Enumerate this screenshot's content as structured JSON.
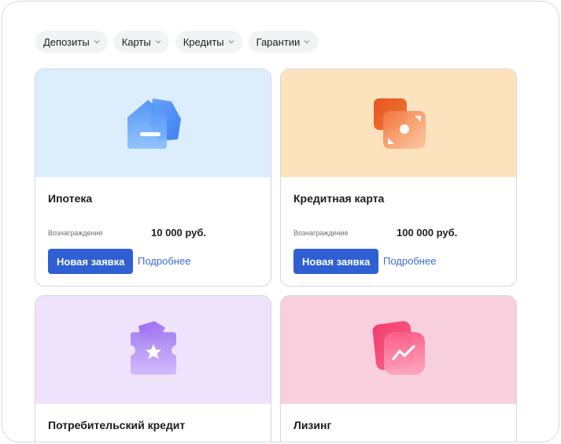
{
  "filters": [
    {
      "label": "Депозиты"
    },
    {
      "label": "Карты"
    },
    {
      "label": "Кредиты"
    },
    {
      "label": "Гарантии"
    }
  ],
  "cards": [
    {
      "title": "Ипотека",
      "reward_label": "Вознаграждение",
      "reward_value": "10 000 руб.",
      "primary_button": "Новая заявка",
      "details_link": "Подробнее",
      "hero_color": "#dcedfc",
      "icon": "house-icon"
    },
    {
      "title": "Кредитная карта",
      "reward_label": "Вознаграждение",
      "reward_value": "100 000 руб.",
      "primary_button": "Новая заявка",
      "details_link": "Подробнее",
      "hero_color": "#fde3bd",
      "icon": "credit-card-icon"
    },
    {
      "title": "Потребительский кредит",
      "hero_color": "#efe2fb",
      "icon": "star-ticket-icon"
    },
    {
      "title": "Лизинг",
      "hero_color": "#f8cfdd",
      "icon": "chart-trend-icon"
    }
  ],
  "colors": {
    "primary_button": "#2f5fd3",
    "link": "#3a6ad6",
    "chip_bg": "#f2f3f5"
  }
}
